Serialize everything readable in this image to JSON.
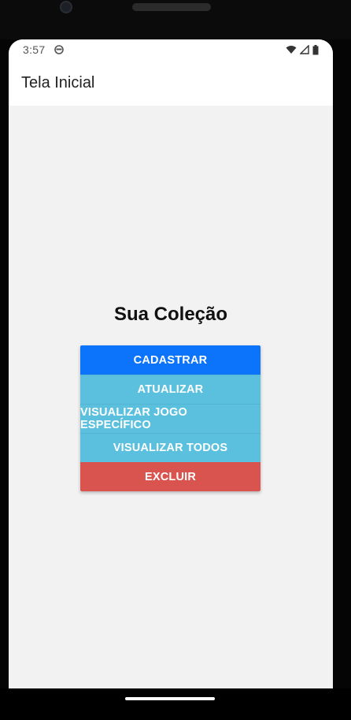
{
  "statusbar": {
    "time": "3:57",
    "icons": [
      "notification-face-icon",
      "wifi-icon",
      "cellular-signal-icon",
      "battery-icon"
    ]
  },
  "appbar": {
    "title": "Tela Inicial"
  },
  "main": {
    "heading": "Sua Coleção",
    "buttons": [
      {
        "label": "CADASTRAR",
        "color": "#0b74fb"
      },
      {
        "label": "ATUALIZAR",
        "color": "#5bc0de"
      },
      {
        "label": "VISUALIZAR JOGO ESPECÍFICO",
        "color": "#5bc0de"
      },
      {
        "label": "VISUALIZAR TODOS",
        "color": "#5bc0de"
      },
      {
        "label": "EXCLUIR",
        "color": "#d9534f"
      }
    ]
  },
  "colors": {
    "background": "#f2f2f2",
    "appbar": "#ffffff",
    "primary": "#0b74fb",
    "info": "#5bc0de",
    "danger": "#d9534f"
  }
}
